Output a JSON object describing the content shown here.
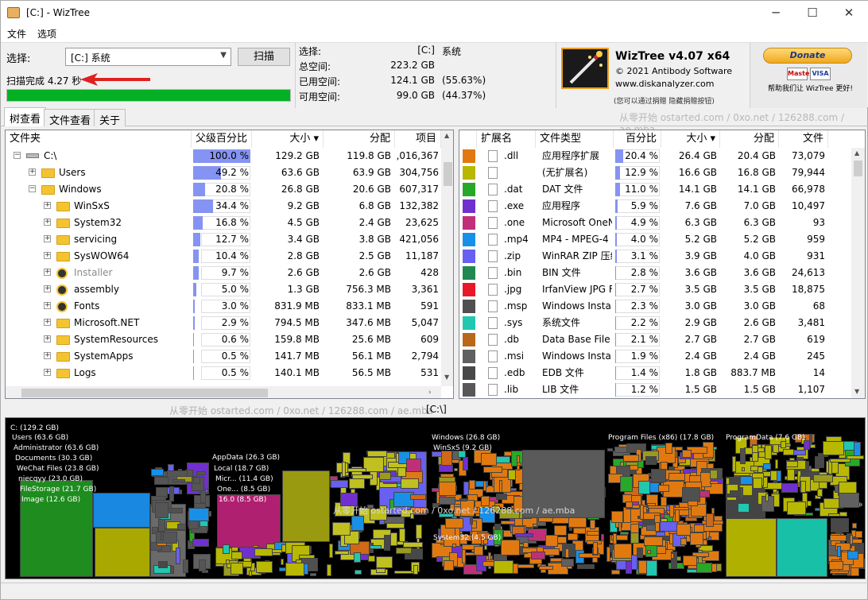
{
  "window": {
    "title": "[C:]  - WizTree"
  },
  "menu": [
    "文件",
    "选项"
  ],
  "top": {
    "select_label": "选择:",
    "drive_value": "[C:] 系统",
    "scan_label": "扫描",
    "status": "扫描完成 4.27 秒",
    "progress": 1.0
  },
  "stats": {
    "sel_k": "选择:",
    "sel_v": "[C:]",
    "sel_p": "系统",
    "total_k": "总空间:",
    "total_v": "223.2 GB",
    "used_k": "已用空间:",
    "used_v": "124.1 GB",
    "used_p": "(55.63%)",
    "free_k": "可用空间:",
    "free_v": "99.0 GB",
    "free_p": "(44.37%)"
  },
  "about": {
    "name": "WizTree v4.07 x64",
    "copyright": "© 2021 Antibody Software",
    "site": "www.diskanalyzer.com",
    "note": "(您可以通过捐赠 隐藏捐赠按钮)"
  },
  "donate": {
    "button": "Donate",
    "text": "帮助我们让 WizTree 更好!",
    "cards": [
      "Master",
      "VISA"
    ]
  },
  "tabs": [
    "树查看",
    "文件查看",
    "关于"
  ],
  "watermark": "从零开始 ostarted.com / 0xo.net / 126288.com / ae.mba",
  "folders": {
    "headers": [
      "文件夹",
      "父级百分比",
      "大小 ▾",
      "分配",
      "项目"
    ],
    "rows": [
      {
        "name": "C:\\",
        "pct": "100.0 %",
        "p": 100,
        "size": "129.2 GB",
        "alloc": "119.8 GB",
        "items": ",016,367",
        "depth": 0,
        "icon": "drive",
        "exp": "−"
      },
      {
        "name": "Users",
        "pct": "49.2 %",
        "p": 49.2,
        "size": "63.6 GB",
        "alloc": "63.9 GB",
        "items": "304,756",
        "depth": 1,
        "icon": "folder",
        "exp": "+"
      },
      {
        "name": "Windows",
        "pct": "20.8 %",
        "p": 20.8,
        "size": "26.8 GB",
        "alloc": "20.6 GB",
        "items": "607,317",
        "depth": 1,
        "icon": "folder",
        "exp": "−"
      },
      {
        "name": "WinSxS",
        "pct": "34.4 %",
        "p": 34.4,
        "size": "9.2 GB",
        "alloc": "6.8 GB",
        "items": "132,382",
        "depth": 2,
        "icon": "folder",
        "exp": "+"
      },
      {
        "name": "System32",
        "pct": "16.8 %",
        "p": 16.8,
        "size": "4.5 GB",
        "alloc": "2.4 GB",
        "items": "23,625",
        "depth": 2,
        "icon": "folder",
        "exp": "+"
      },
      {
        "name": "servicing",
        "pct": "12.7 %",
        "p": 12.7,
        "size": "3.4 GB",
        "alloc": "3.8 GB",
        "items": "421,056",
        "depth": 2,
        "icon": "folder",
        "exp": "+"
      },
      {
        "name": "SysWOW64",
        "pct": "10.4 %",
        "p": 10.4,
        "size": "2.8 GB",
        "alloc": "2.5 GB",
        "items": "11,187",
        "depth": 2,
        "icon": "folder",
        "exp": "+"
      },
      {
        "name": "Installer",
        "pct": "9.7 %",
        "p": 9.7,
        "size": "2.6 GB",
        "alloc": "2.6 GB",
        "items": "428",
        "depth": 2,
        "icon": "gear",
        "exp": "+",
        "dim": true
      },
      {
        "name": "assembly",
        "pct": "5.0 %",
        "p": 5.0,
        "size": "1.3 GB",
        "alloc": "756.3 MB",
        "items": "3,361",
        "depth": 2,
        "icon": "gear",
        "exp": "+"
      },
      {
        "name": "Fonts",
        "pct": "3.0 %",
        "p": 3.0,
        "size": "831.9 MB",
        "alloc": "833.1 MB",
        "items": "591",
        "depth": 2,
        "icon": "gear",
        "exp": "+"
      },
      {
        "name": "Microsoft.NET",
        "pct": "2.9 %",
        "p": 2.9,
        "size": "794.5 MB",
        "alloc": "347.6 MB",
        "items": "5,047",
        "depth": 2,
        "icon": "folder",
        "exp": "+"
      },
      {
        "name": "SystemResources",
        "pct": "0.6 %",
        "p": 0.6,
        "size": "159.8 MB",
        "alloc": "25.6 MB",
        "items": "609",
        "depth": 2,
        "icon": "folder",
        "exp": "+"
      },
      {
        "name": "SystemApps",
        "pct": "0.5 %",
        "p": 0.5,
        "size": "141.7 MB",
        "alloc": "56.1 MB",
        "items": "2,794",
        "depth": 2,
        "icon": "folder",
        "exp": "+"
      },
      {
        "name": "Logs",
        "pct": "0.5 %",
        "p": 0.5,
        "size": "140.1 MB",
        "alloc": "56.5 MB",
        "items": "531",
        "depth": 2,
        "icon": "folder",
        "exp": "+"
      }
    ]
  },
  "exts": {
    "headers": [
      "扩展名",
      "文件类型",
      "百分比",
      "大小 ▾",
      "分配",
      "文件"
    ],
    "rows": [
      {
        "color": "#e07a10",
        "ext": ".dll",
        "type": "应用程序扩展",
        "pct": "20.4 %",
        "p": 20.4,
        "size": "26.4 GB",
        "alloc": "20.4 GB",
        "files": "73,079"
      },
      {
        "color": "#b8b800",
        "ext": "",
        "type": "(无扩展名)",
        "pct": "12.9 %",
        "p": 12.9,
        "size": "16.6 GB",
        "alloc": "16.8 GB",
        "files": "79,944"
      },
      {
        "color": "#28a828",
        "ext": ".dat",
        "type": "DAT 文件",
        "pct": "11.0 %",
        "p": 11.0,
        "size": "14.1 GB",
        "alloc": "14.1 GB",
        "files": "66,978"
      },
      {
        "color": "#7030d0",
        "ext": ".exe",
        "type": "应用程序",
        "pct": "5.9 %",
        "p": 5.9,
        "size": "7.6 GB",
        "alloc": "7.0 GB",
        "files": "10,497"
      },
      {
        "color": "#c03078",
        "ext": ".one",
        "type": "Microsoft OneN",
        "pct": "4.9 %",
        "p": 4.9,
        "size": "6.3 GB",
        "alloc": "6.3 GB",
        "files": "93"
      },
      {
        "color": "#1890e8",
        "ext": ".mp4",
        "type": "MP4 - MPEG-4 E",
        "pct": "4.0 %",
        "p": 4.0,
        "size": "5.2 GB",
        "alloc": "5.2 GB",
        "files": "959"
      },
      {
        "color": "#6860f0",
        "ext": ".zip",
        "type": "WinRAR ZIP 压缩",
        "pct": "3.1 %",
        "p": 3.1,
        "size": "3.9 GB",
        "alloc": "4.0 GB",
        "files": "931"
      },
      {
        "color": "#208850",
        "ext": ".bin",
        "type": "BIN 文件",
        "pct": "2.8 %",
        "p": 2.8,
        "size": "3.6 GB",
        "alloc": "3.6 GB",
        "files": "24,613"
      },
      {
        "color": "#e81828",
        "ext": ".jpg",
        "type": "IrfanView JPG Fil",
        "pct": "2.7 %",
        "p": 2.7,
        "size": "3.5 GB",
        "alloc": "3.5 GB",
        "files": "18,875"
      },
      {
        "color": "#505050",
        "ext": ".msp",
        "type": "Windows Installe",
        "pct": "2.3 %",
        "p": 2.3,
        "size": "3.0 GB",
        "alloc": "3.0 GB",
        "files": "68"
      },
      {
        "color": "#20c8b0",
        "ext": ".sys",
        "type": "系统文件",
        "pct": "2.2 %",
        "p": 2.2,
        "size": "2.9 GB",
        "alloc": "2.6 GB",
        "files": "3,481"
      },
      {
        "color": "#b86818",
        "ext": ".db",
        "type": "Data Base File",
        "pct": "2.1 %",
        "p": 2.1,
        "size": "2.7 GB",
        "alloc": "2.7 GB",
        "files": "619"
      },
      {
        "color": "#606060",
        "ext": ".msi",
        "type": "Windows Installe",
        "pct": "1.9 %",
        "p": 1.9,
        "size": "2.4 GB",
        "alloc": "2.4 GB",
        "files": "245"
      },
      {
        "color": "#484848",
        "ext": ".edb",
        "type": "EDB 文件",
        "pct": "1.4 %",
        "p": 1.4,
        "size": "1.8 GB",
        "alloc": "883.7 MB",
        "files": "14"
      },
      {
        "color": "#585858",
        "ext": ".lib",
        "type": "LIB 文件",
        "pct": "1.2 %",
        "p": 1.2,
        "size": "1.5 GB",
        "alloc": "1.5 GB",
        "files": "1,107"
      }
    ]
  },
  "path": "[C:\\]",
  "treemap": {
    "labels": [
      "C: (129.2 GB)",
      "Users (63.6 GB)",
      "Administrator (63.6 GB)",
      "Documents (30.3 GB)",
      "WeChat Files (23.8 GB)",
      "niecqyy (23.0 GB)",
      "FileStorage (21.7 GB)",
      "Image (12.6 GB)",
      "AppData (26.3 GB)",
      "Local (18.7 GB)",
      "Micr... (11.4 GB)",
      "One... (8.5 GB)",
      "16.0 (8.5 GB)",
      "Windows (26.8 GB)",
      "WinSxS (9.2 GB)",
      "System32 (4.5 GB)",
      "Program Files (x86) (17.8 GB)",
      "ProgramData (7.6 GB)"
    ]
  }
}
